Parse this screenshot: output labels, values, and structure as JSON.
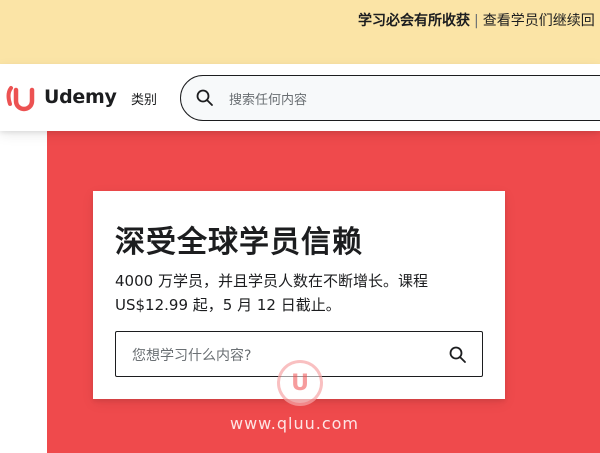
{
  "promo": {
    "text": "学习必会有所收获",
    "separator": "|",
    "link": "查看学员们继续回"
  },
  "header": {
    "logo_text": "Udemy",
    "categories_label": "类别",
    "search_placeholder": "搜索任何内容"
  },
  "hero": {
    "title": "深受全球学员信赖",
    "body": "4000 万学员，并且学员人数在不断增长。课程 US$12.99 起，5 月 12 日截止。",
    "search_placeholder": "您想学习什么内容?"
  },
  "watermark": {
    "letter": "U",
    "text": "www.qluu.com"
  },
  "colors": {
    "promo_bg": "#fbe4a6",
    "hero_bg": "#ef4a4c",
    "brand_accent": "#ec5252",
    "text": "#1c1d1f"
  },
  "icons": {
    "logo": "udemy-u-icon",
    "search": "search-icon"
  }
}
